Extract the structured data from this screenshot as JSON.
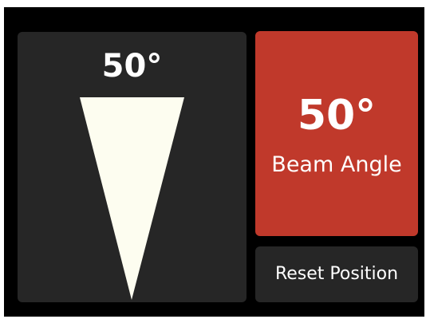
{
  "beam_view": {
    "angle_label": "50°",
    "angle_degrees": 50
  },
  "angle_card": {
    "value": "50°",
    "caption": "Beam Angle"
  },
  "reset_button": {
    "label": "Reset Position"
  },
  "colors": {
    "screen_background": "#000000",
    "panel_background": "#262626",
    "accent": "#c0392b",
    "beam_fill": "#fdfdf0",
    "text": "#ffffff"
  }
}
